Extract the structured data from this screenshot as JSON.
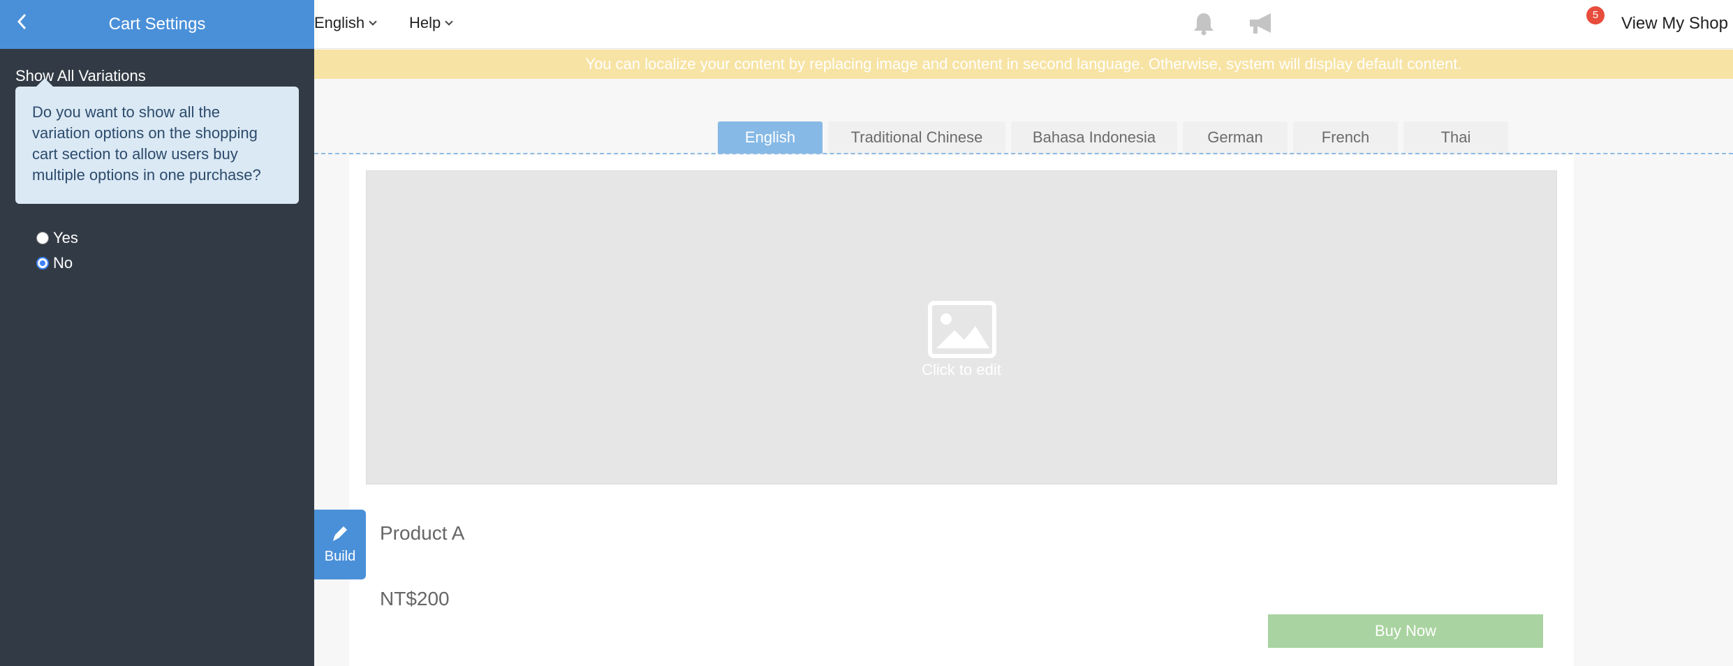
{
  "sidebar": {
    "title": "Cart Settings",
    "section_label": "Show All Variations",
    "info_text": "Do you want to show all the variation options on the shopping cart section to allow users buy multiple options in one purchase?",
    "options": [
      {
        "label": "Yes",
        "checked": false
      },
      {
        "label": "No",
        "checked": true
      }
    ]
  },
  "topbar": {
    "language_menu": "English",
    "help_menu": "Help",
    "notification_count": "5",
    "view_shop": "View My Shop"
  },
  "banner": {
    "text": "You can localize your content by replacing image and content in second language. Otherwise, system will display default content."
  },
  "language_tabs": [
    "English",
    "Traditional Chinese",
    "Bahasa Indonesia",
    "German",
    "French",
    "Thai"
  ],
  "active_tab": "English",
  "content": {
    "image_placeholder": "Click to edit",
    "product_name": "Product A",
    "price": "NT$200",
    "buy_button": "Buy Now"
  },
  "build_button": "Build",
  "colors": {
    "sidebar_bg": "#323b45",
    "accent": "#4a90d9",
    "banner_bg": "#f7e3a4",
    "buy_button": "#a9d3a0",
    "badge": "#e74c3c"
  }
}
